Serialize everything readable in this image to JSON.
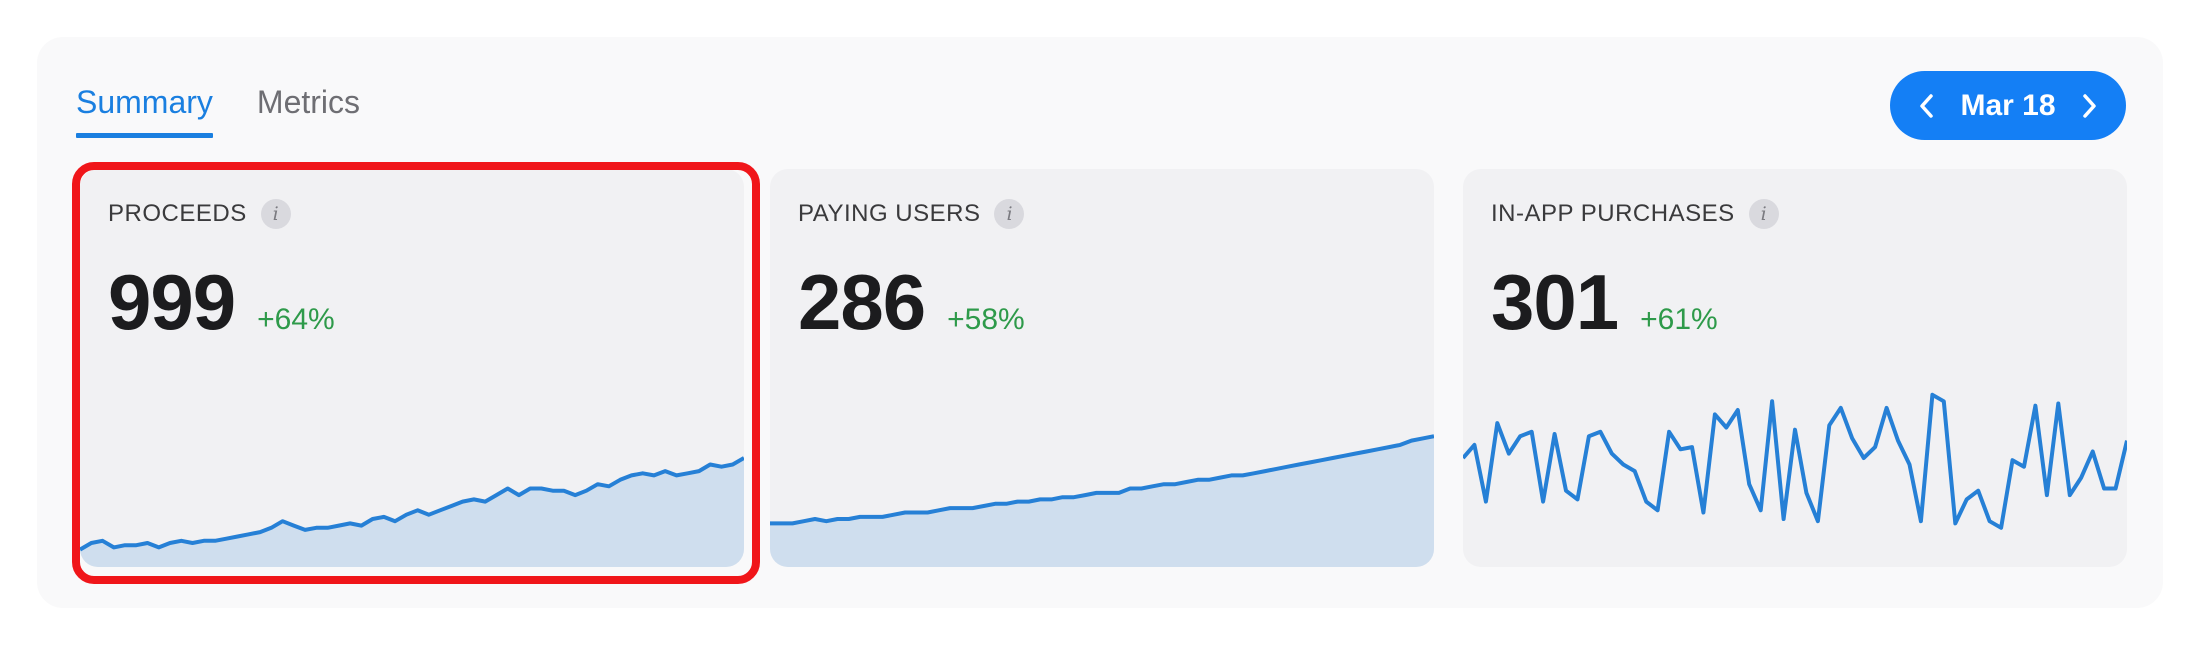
{
  "tabs": [
    {
      "label": "Summary",
      "active": true
    },
    {
      "label": "Metrics",
      "active": false
    }
  ],
  "date_picker": {
    "label": "Mar 18",
    "prev_icon": "chevron-left-icon",
    "next_icon": "chevron-right-icon",
    "color": "#147ff5"
  },
  "cards": [
    {
      "title": "PROCEEDS",
      "value": "999",
      "delta": "+64%",
      "chart": "area",
      "series": [
        0.08,
        0.11,
        0.12,
        0.09,
        0.1,
        0.1,
        0.11,
        0.09,
        0.11,
        0.12,
        0.11,
        0.12,
        0.12,
        0.13,
        0.14,
        0.15,
        0.16,
        0.18,
        0.21,
        0.19,
        0.17,
        0.18,
        0.18,
        0.19,
        0.2,
        0.19,
        0.22,
        0.23,
        0.21,
        0.24,
        0.26,
        0.24,
        0.26,
        0.28,
        0.3,
        0.31,
        0.3,
        0.33,
        0.36,
        0.33,
        0.36,
        0.36,
        0.35,
        0.35,
        0.33,
        0.35,
        0.38,
        0.37,
        0.4,
        0.42,
        0.43,
        0.42,
        0.44,
        0.42,
        0.43,
        0.44,
        0.47,
        0.46,
        0.47,
        0.5
      ]
    },
    {
      "title": "PAYING USERS",
      "value": "286",
      "delta": "+58%",
      "chart": "area",
      "series": [
        0.2,
        0.2,
        0.2,
        0.21,
        0.22,
        0.21,
        0.22,
        0.22,
        0.23,
        0.23,
        0.23,
        0.24,
        0.25,
        0.25,
        0.25,
        0.26,
        0.27,
        0.27,
        0.27,
        0.28,
        0.29,
        0.29,
        0.3,
        0.3,
        0.31,
        0.31,
        0.32,
        0.32,
        0.33,
        0.34,
        0.34,
        0.34,
        0.36,
        0.36,
        0.37,
        0.38,
        0.38,
        0.39,
        0.4,
        0.4,
        0.41,
        0.42,
        0.42,
        0.43,
        0.44,
        0.45,
        0.46,
        0.47,
        0.48,
        0.49,
        0.5,
        0.51,
        0.52,
        0.53,
        0.54,
        0.55,
        0.56,
        0.58,
        0.59,
        0.6
      ]
    },
    {
      "title": "IN-APP PURCHASES",
      "value": "301",
      "delta": "+61%",
      "chart": "line",
      "series": [
        0.5,
        0.56,
        0.3,
        0.66,
        0.52,
        0.6,
        0.62,
        0.3,
        0.61,
        0.35,
        0.31,
        0.6,
        0.62,
        0.52,
        0.47,
        0.44,
        0.3,
        0.26,
        0.62,
        0.54,
        0.55,
        0.25,
        0.7,
        0.64,
        0.72,
        0.38,
        0.26,
        0.76,
        0.22,
        0.63,
        0.34,
        0.21,
        0.65,
        0.73,
        0.59,
        0.5,
        0.55,
        0.73,
        0.58,
        0.47,
        0.21,
        0.79,
        0.76,
        0.2,
        0.31,
        0.35,
        0.21,
        0.18,
        0.49,
        0.46,
        0.74,
        0.33,
        0.75,
        0.33,
        0.41,
        0.53,
        0.36,
        0.36,
        0.58
      ]
    }
  ],
  "colors": {
    "accent": "#1a7fe0",
    "positive": "#2e9a4a",
    "line": "#2680d6",
    "fill": "#cfdeee",
    "highlight": "#f0161a"
  }
}
